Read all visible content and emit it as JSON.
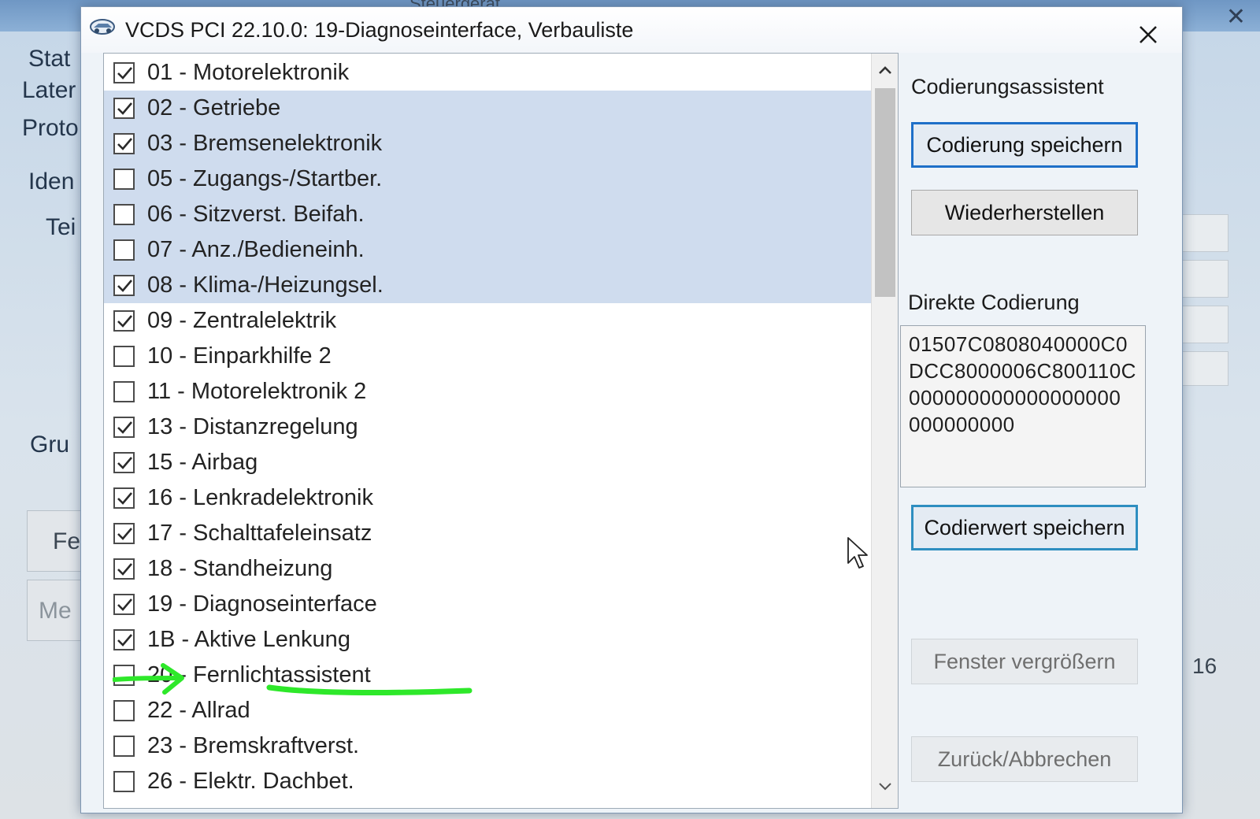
{
  "background_window": {
    "partial_title": "Steuergerät",
    "close_glyph": "✕",
    "labels": [
      "Stat",
      "Later",
      "Proto",
      "Iden",
      "Tei",
      "Gru"
    ],
    "buttons": [
      "Fe",
      "Me"
    ],
    "right_value": "16"
  },
  "dialog": {
    "title": "VCDS PCI 22.10.0: 19-Diagnoseinterface,  Verbauliste",
    "icon": "car-key-icon",
    "close_icon": "close-icon"
  },
  "modules": [
    {
      "label": "01 - Motorelektronik",
      "checked": true,
      "selected": false
    },
    {
      "label": "02 - Getriebe",
      "checked": true,
      "selected": true
    },
    {
      "label": "03 - Bremsenelektronik",
      "checked": true,
      "selected": true
    },
    {
      "label": "05 - Zugangs-/Startber.",
      "checked": false,
      "selected": true
    },
    {
      "label": "06 - Sitzverst. Beifah.",
      "checked": false,
      "selected": true
    },
    {
      "label": "07 - Anz./Bedieneinh.",
      "checked": false,
      "selected": true
    },
    {
      "label": "08 - Klima-/Heizungsel.",
      "checked": true,
      "selected": true
    },
    {
      "label": "09 - Zentralelektrik",
      "checked": true,
      "selected": false
    },
    {
      "label": "10 - Einparkhilfe 2",
      "checked": false,
      "selected": false
    },
    {
      "label": "11 - Motorelektronik 2",
      "checked": false,
      "selected": false
    },
    {
      "label": "13 - Distanzregelung",
      "checked": true,
      "selected": false
    },
    {
      "label": "15 - Airbag",
      "checked": true,
      "selected": false
    },
    {
      "label": "16 - Lenkradelektronik",
      "checked": true,
      "selected": false
    },
    {
      "label": "17 - Schalttafeleinsatz",
      "checked": true,
      "selected": false
    },
    {
      "label": "18 - Standheizung",
      "checked": true,
      "selected": false
    },
    {
      "label": "19 - Diagnoseinterface",
      "checked": true,
      "selected": false
    },
    {
      "label": "1B - Aktive Lenkung",
      "checked": true,
      "selected": false
    },
    {
      "label": "20 - Fernlichtassistent",
      "checked": false,
      "selected": false
    },
    {
      "label": "22 - Allrad",
      "checked": false,
      "selected": false
    },
    {
      "label": "23 - Bremskraftverst.",
      "checked": false,
      "selected": false
    },
    {
      "label": "26 - Elektr. Dachbet.",
      "checked": false,
      "selected": false
    }
  ],
  "right_panel": {
    "assistant_heading": "Codierungsassistent",
    "save_coding_label": "Codierung speichern",
    "restore_label": "Wiederherstellen",
    "direct_coding_heading": "Direkte Codierung",
    "direct_coding_value": "01507C0808040000C0\nDCC8000006C800110C\n000000000000000000\n000000000",
    "save_value_label": "Codierwert speichern",
    "enlarge_window_label": "Fenster vergrößern",
    "back_cancel_label": "Zurück/Abbrechen"
  },
  "colors": {
    "selection": "#cfdcee",
    "primary_border": "#1e6fc8",
    "annotation_green": "#2ee82a"
  }
}
